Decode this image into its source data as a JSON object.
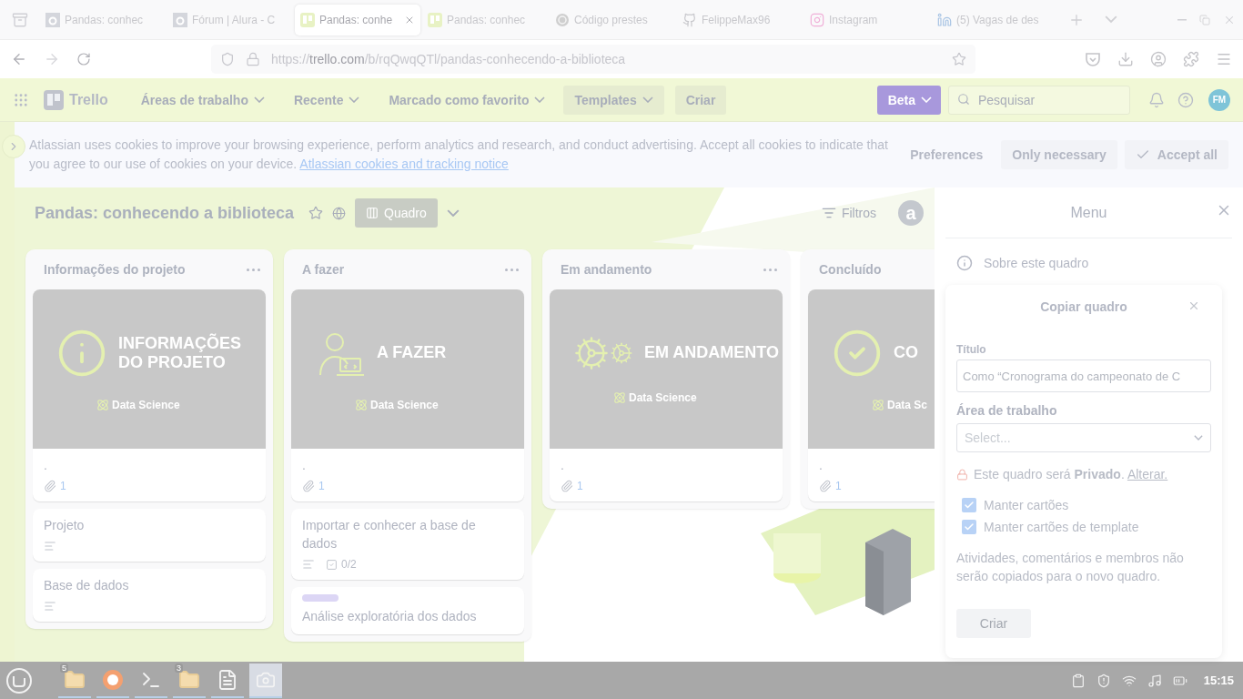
{
  "browser": {
    "tabs": [
      {
        "title": "Pandas: conhec",
        "kind": "alura",
        "selected": false
      },
      {
        "title": "Fórum | Alura - C",
        "kind": "alura",
        "selected": false
      },
      {
        "title": "Pandas: conhe",
        "kind": "trello",
        "selected": true
      },
      {
        "title": "Pandas: conhec",
        "kind": "trello",
        "selected": false
      },
      {
        "title": "Código prestes",
        "kind": "swirl",
        "selected": false
      },
      {
        "title": "FelippeMax96",
        "kind": "github",
        "selected": false
      },
      {
        "title": "Instagram",
        "kind": "instagram",
        "selected": false
      },
      {
        "title": "(5) Vagas de des",
        "kind": "linkedin",
        "selected": false
      }
    ],
    "url": {
      "scheme": "https://",
      "host": "trello.com",
      "path": "/b/rqQwqQTl/pandas-conhecendo-a-biblioteca"
    }
  },
  "header": {
    "logo": "Trello",
    "menus": [
      {
        "label": "Áreas de trabalho",
        "kind": "menu"
      },
      {
        "label": "Recente",
        "kind": "menu"
      },
      {
        "label": "Marcado como favorito",
        "kind": "menu"
      },
      {
        "label": "Templates",
        "kind": "shaded"
      }
    ],
    "create": "Criar",
    "beta": "Beta",
    "search": {
      "placeholder": "Pesquisar"
    },
    "avatar": "FM"
  },
  "cookie_banner": {
    "text": "Atlassian uses cookies to improve your browsing experience, perform analytics and research, and conduct advertising. Accept all cookies to indicate that you agree to our use of cookies on your device.",
    "link": "Atlassian cookies and tracking notice",
    "buttons": [
      {
        "label": "Preferences",
        "kind": "text"
      },
      {
        "label": "Only necessary",
        "kind": "plain"
      },
      {
        "label": "Accept all",
        "kind": "check"
      }
    ]
  },
  "board": {
    "title": "Pandas: conhecendo a biblioteca",
    "view": "Quadro",
    "filter": "Filtros",
    "member": "a",
    "lists": [
      {
        "title": "Informações do projeto",
        "cards": [
          {
            "kind": "cover",
            "cover": {
              "kind": "info",
              "title": "INFORMAÇÕES DO PROJETO",
              "badge": "Data Science"
            },
            "title": ".",
            "attachments": "1"
          },
          {
            "kind": "plain",
            "title": "Projeto",
            "description": true
          },
          {
            "kind": "plain",
            "title": "Base de dados",
            "description": true
          }
        ]
      },
      {
        "title": "A fazer",
        "cards": [
          {
            "kind": "cover",
            "cover": {
              "kind": "coder",
              "title": "A FAZER",
              "badge": "Data Science"
            },
            "title": ".",
            "attachments": "1"
          },
          {
            "kind": "plain",
            "title": "Importar e conhecer a base de dados",
            "description": true,
            "checklist": "0/2"
          },
          {
            "kind": "plain",
            "title": "Análise exploratória dos dados",
            "description": false,
            "color": "#dcd6f5"
          }
        ]
      },
      {
        "title": "Em andamento",
        "cards": [
          {
            "kind": "cover",
            "cover": {
              "kind": "gears",
              "title": "EM ANDAMENTO",
              "badge": "Data Science"
            },
            "title": ".",
            "attachments": "1"
          }
        ]
      },
      {
        "title": "Concluído",
        "cards": [
          {
            "kind": "cover",
            "cover": {
              "kind": "check",
              "title": "CO",
              "badge": "Data Sc"
            },
            "title": ".",
            "attachments": "1"
          }
        ]
      }
    ]
  },
  "menu": {
    "title": "Menu",
    "items": [
      {
        "label": "Sobre este quadro"
      }
    ]
  },
  "copy_dialog": {
    "title": "Copiar quadro",
    "title_label": "Título",
    "title_placeholder": "Como “Cronograma do campeonato de C",
    "workspace_label": "Área de trabalho",
    "workspace_placeholder": "Select...",
    "privacy": "Este quadro será **Privado**.",
    "privacy_link": "Alterar.",
    "options": [
      {
        "label": "Manter cartões",
        "checked": true
      },
      {
        "label": "Manter cartões de template",
        "checked": true
      }
    ],
    "note": "Atividades, comentários e membros não serão copiados para o novo quadro.",
    "submit": "Criar"
  },
  "taskbar": {
    "apps": [
      {
        "kind": "folder",
        "badge": "5",
        "active": false
      },
      {
        "kind": "firefox",
        "active": false
      },
      {
        "kind": "terminal",
        "active": false
      },
      {
        "kind": "folder",
        "badge": "3",
        "active": false
      },
      {
        "kind": "editor",
        "active": false
      },
      {
        "kind": "screenshot",
        "active": true
      }
    ],
    "clock": "15:15"
  }
}
